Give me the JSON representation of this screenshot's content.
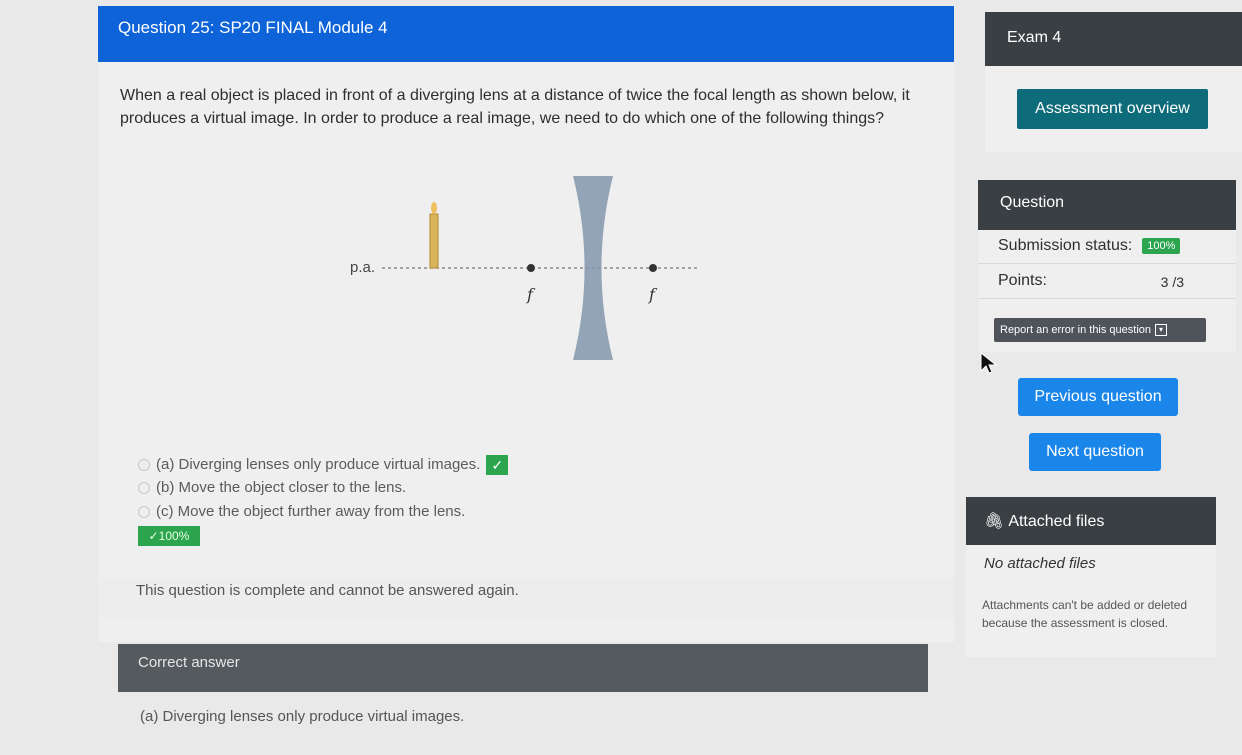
{
  "question": {
    "header": "Question 25: SP20 FINAL Module 4",
    "text": "When a real object is placed in front of a diverging lens at a distance of twice the focal length as shown below, it produces a virtual image.   In order to produce a real image, we need to do which one of the following things?",
    "diagram": {
      "axis_label": "p.a.",
      "focal_label_left": "f",
      "focal_label_right": "f"
    },
    "options": [
      {
        "label": "(a) Diverging lenses only produce virtual images.",
        "correct": true
      },
      {
        "label": "(b) Move the object closer to the lens.",
        "correct": false
      },
      {
        "label": "(c) Move the object further away from the lens.",
        "correct": false
      }
    ],
    "score_badge": "100%",
    "complete_message": "This question is complete and cannot be answered again.",
    "correct_answer_header": "Correct answer",
    "correct_answer_text": "(a) Diverging lenses only produce virtual images."
  },
  "sidebar": {
    "exam_title": "Exam 4",
    "overview_button": "Assessment overview",
    "question_panel_title": "Question",
    "submission_status_label": "Submission status:",
    "submission_status_value": "100%",
    "points_label": "Points:",
    "points_value": "3 /3",
    "report_button": "Report an error in this question",
    "previous_button": "Previous question",
    "next_button": "Next question",
    "attached_files_title": "Attached files",
    "no_files": "No attached files",
    "attachments_note": "Attachments can't be added or deleted because the assessment is closed."
  },
  "colors": {
    "header_blue": "#0f63d8",
    "dark_panel": "#3a3f44",
    "teal_button": "#0e6b7a",
    "nav_button": "#1a86ea",
    "success_green": "#2da44e"
  }
}
